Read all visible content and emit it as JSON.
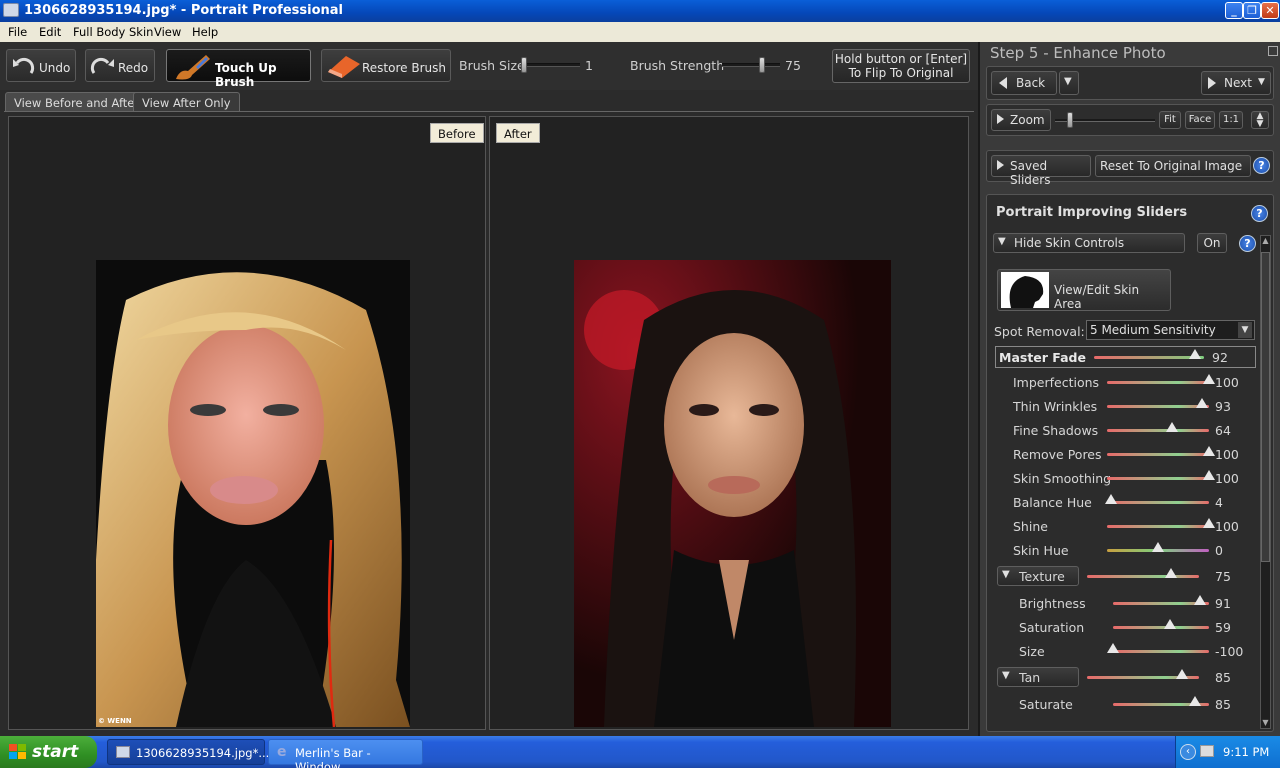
{
  "window": {
    "title": "1306628935194.jpg* - Portrait Professional"
  },
  "menu": [
    "File",
    "Edit",
    "Full Body Skin",
    "View",
    "Help"
  ],
  "toolbar": {
    "undo": "Undo",
    "redo": "Redo",
    "touch_up": "Touch Up Brush",
    "restore": "Restore Brush",
    "brush_size_label": "Brush Size",
    "brush_size_value": "1",
    "brush_strength_label": "Brush Strength",
    "brush_strength_value": "75",
    "flip_line1": "Hold button or [Enter]",
    "flip_line2": "To Flip To Original"
  },
  "view_tabs": [
    "View Before and After",
    "View After Only"
  ],
  "panes": {
    "before": "Before",
    "after": "After",
    "watermark": "© WENN"
  },
  "right_panel": {
    "step_title": "Step 5 - Enhance Photo",
    "back": "Back",
    "next": "Next",
    "zoom": "Zoom",
    "fit": "Fit",
    "face": "Face",
    "one_to_one": "1:1",
    "saved_sliders": "Saved Sliders",
    "reset": "Reset To Original Image",
    "sliders_title": "Portrait Improving Sliders",
    "hide_skin": "Hide Skin Controls",
    "on": "On",
    "view_edit_skin": "View/Edit Skin Area",
    "spot_removal_label": "Spot Removal:",
    "spot_removal_value": "5 Medium Sensitivity"
  },
  "sliders": [
    {
      "label": "Master Fade",
      "value": "92"
    },
    {
      "label": "Imperfections",
      "value": "100"
    },
    {
      "label": "Thin Wrinkles",
      "value": "93"
    },
    {
      "label": "Fine Shadows",
      "value": "64"
    },
    {
      "label": "Remove Pores",
      "value": "100"
    },
    {
      "label": "Skin Smoothing",
      "value": "100"
    },
    {
      "label": "Balance Hue",
      "value": "4"
    },
    {
      "label": "Shine",
      "value": "100"
    },
    {
      "label": "Skin Hue",
      "value": "0"
    },
    {
      "label": "Texture",
      "value": "75"
    },
    {
      "label": "Brightness",
      "value": "91"
    },
    {
      "label": "Saturation",
      "value": "59"
    },
    {
      "label": "Size",
      "value": "-100"
    },
    {
      "label": "Tan",
      "value": "85"
    },
    {
      "label": "Saturate",
      "value": "85"
    }
  ],
  "slider_levels": [
    0.92,
    1.0,
    0.93,
    0.64,
    1.0,
    1.0,
    0.04,
    1.0,
    0.5,
    0.75,
    0.91,
    0.59,
    0.0,
    0.85,
    0.85
  ],
  "taskbar": {
    "start": "start",
    "task1": "1306628935194.jpg*...",
    "task2": "Merlin's Bar - Window...",
    "clock": "9:11 PM"
  }
}
